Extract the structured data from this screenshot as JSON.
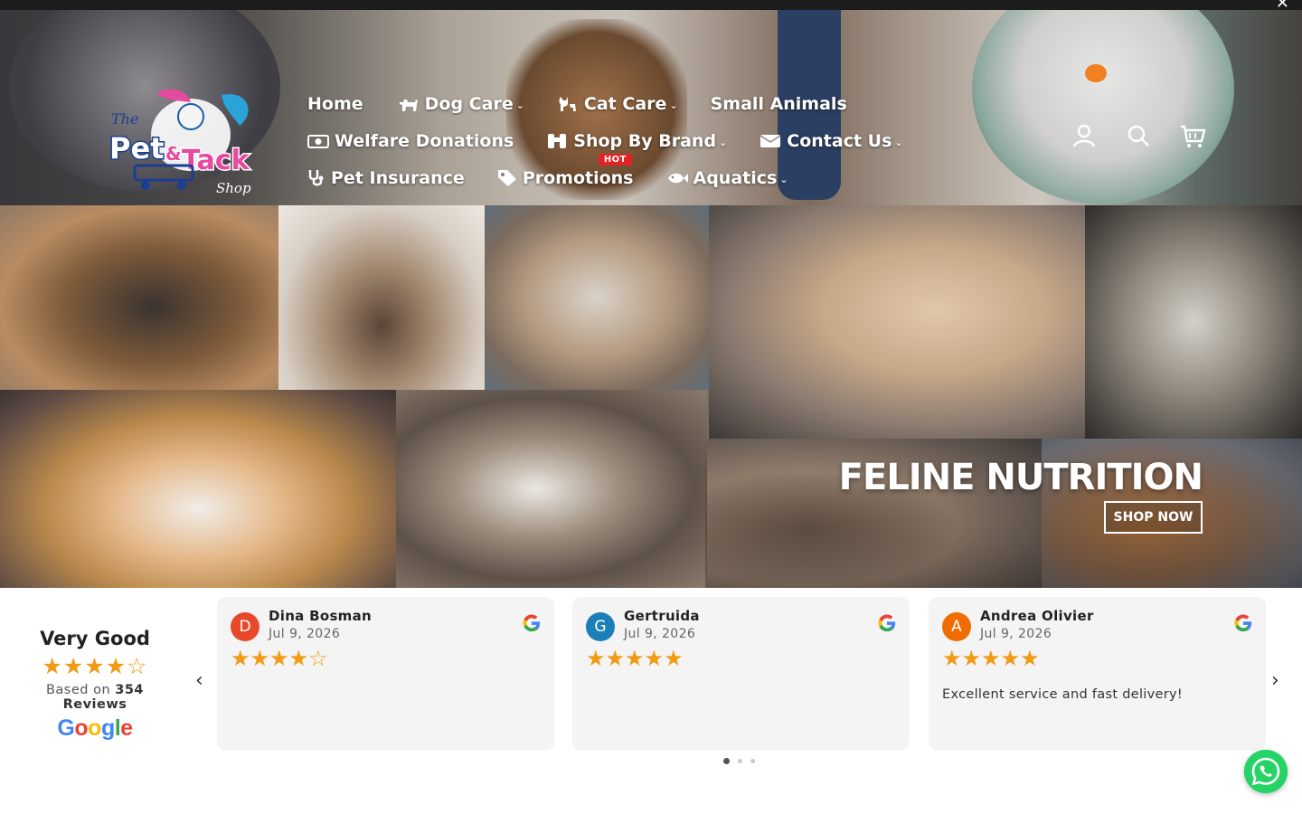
{
  "topbar": {
    "close_label": "✕"
  },
  "brand": {
    "logo_alt": "The Pet & Tack Shop",
    "logo_line1": "The",
    "logo_line2": "Pet",
    "logo_amp": "&",
    "logo_line3": "Tack",
    "logo_line4": "Shop"
  },
  "nav": {
    "row1": [
      {
        "label": "Home",
        "icon": "",
        "dropdown": false
      },
      {
        "label": "Dog Care",
        "icon": "dog-icon",
        "dropdown": true
      },
      {
        "label": "Cat Care",
        "icon": "cat-icon",
        "dropdown": true
      },
      {
        "label": "Small Animals",
        "icon": "",
        "dropdown": false
      }
    ],
    "row2": [
      {
        "label": "Welfare Donations",
        "icon": "money-icon",
        "dropdown": false
      },
      {
        "label": "Shop By Brand",
        "icon": "binoculars-icon",
        "dropdown": true
      },
      {
        "label": "Contact Us",
        "icon": "envelope-icon",
        "dropdown": true
      }
    ],
    "row3": [
      {
        "label": "Pet Insurance",
        "icon": "stethoscope-icon",
        "dropdown": false
      },
      {
        "label": "Promotions",
        "icon": "tag-icon",
        "dropdown": false,
        "badge": "HOT"
      },
      {
        "label": "Aquatics",
        "icon": "fish-icon",
        "dropdown": true
      }
    ]
  },
  "header_icons": [
    "account-icon",
    "search-icon",
    "cart-icon"
  ],
  "hero": {
    "title": "FELINE NUTRITION",
    "button": "SHOP NOW"
  },
  "reviews": {
    "summary": {
      "rating_label": "Very Good",
      "stars": 4,
      "based_prefix": "Based on",
      "count_label": "354 Reviews",
      "source": "Google"
    },
    "cards": [
      {
        "initial": "D",
        "avatar_color": "#e8492b",
        "name": "Dina Bosman",
        "date": "Jul 9, 2026",
        "stars": 4,
        "text": ""
      },
      {
        "initial": "G",
        "avatar_color": "#1c7fb8",
        "name": "Gertruida",
        "date": "Jul 9, 2026",
        "stars": 5,
        "text": ""
      },
      {
        "initial": "A",
        "avatar_color": "#ef6c00",
        "name": "Andrea Olivier",
        "date": "Jul 9, 2026",
        "stars": 5,
        "text": "Excellent service and fast delivery!"
      }
    ],
    "pagination": {
      "pages": 3,
      "active": 1
    },
    "prev_label": "‹",
    "next_label": "›"
  },
  "colors": {
    "star": "#f19a14",
    "hot_badge": "#e02424",
    "whatsapp": "#25d366"
  }
}
